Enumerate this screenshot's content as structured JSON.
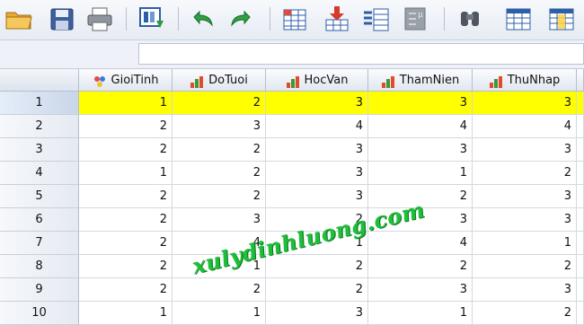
{
  "toolbar": {
    "icons": [
      "open-folder-icon",
      "save-icon",
      "print-icon",
      "recall-dialog-icon",
      "undo-icon",
      "redo-icon",
      "goto-case-icon",
      "goto-variable-icon",
      "variables-icon",
      "run-descriptives-icon",
      "find-icon",
      "insert-cases-icon",
      "insert-variable-icon"
    ]
  },
  "grid": {
    "columns": [
      {
        "label": "GioiTinh",
        "measure": "nominal-icon"
      },
      {
        "label": "DoTuoi",
        "measure": "ordinal-bar-icon"
      },
      {
        "label": "HocVan",
        "measure": "ordinal-bar-icon"
      },
      {
        "label": "ThamNien",
        "measure": "ordinal-bar-icon"
      },
      {
        "label": "ThuNhap",
        "measure": "ordinal-bar-icon"
      }
    ],
    "rows": [
      {
        "n": "1",
        "values": [
          "1",
          "2",
          "3",
          "3",
          "3"
        ]
      },
      {
        "n": "2",
        "values": [
          "2",
          "3",
          "4",
          "4",
          "4"
        ]
      },
      {
        "n": "3",
        "values": [
          "2",
          "2",
          "3",
          "3",
          "3"
        ]
      },
      {
        "n": "4",
        "values": [
          "1",
          "2",
          "3",
          "1",
          "2"
        ]
      },
      {
        "n": "5",
        "values": [
          "2",
          "2",
          "3",
          "2",
          "3"
        ]
      },
      {
        "n": "6",
        "values": [
          "2",
          "3",
          "2",
          "3",
          "3"
        ]
      },
      {
        "n": "7",
        "values": [
          "2",
          "4",
          "1",
          "4",
          "1"
        ]
      },
      {
        "n": "8",
        "values": [
          "2",
          "1",
          "2",
          "2",
          "2"
        ]
      },
      {
        "n": "9",
        "values": [
          "2",
          "2",
          "2",
          "3",
          "3"
        ]
      },
      {
        "n": "10",
        "values": [
          "1",
          "1",
          "3",
          "1",
          "2"
        ]
      }
    ],
    "selected_row": "1",
    "selected_color": "#ffff00"
  },
  "watermark": {
    "text": "xulydinhluong.com",
    "color": "#1fbf3a"
  }
}
